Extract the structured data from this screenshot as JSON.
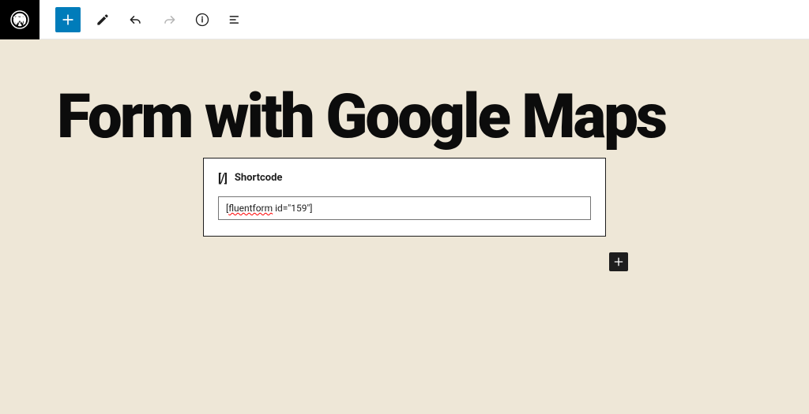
{
  "toolbar": {
    "wp_logo_label": "WordPress",
    "add_block_label": "Add block",
    "edit_label": "Edit",
    "undo_label": "Undo",
    "redo_label": "Redo",
    "info_label": "Details",
    "outline_label": "Outline"
  },
  "page": {
    "title": "Form with Google Maps"
  },
  "shortcode_block": {
    "label": "Shortcode",
    "icon_text": "[/]",
    "value": "[fluentform id=\"159\"]"
  },
  "appender": {
    "label": "Add block"
  }
}
